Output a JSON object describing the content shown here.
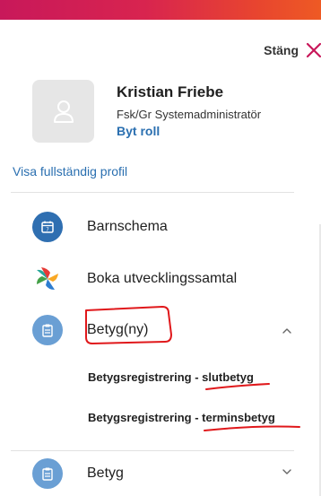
{
  "header": {
    "close_label": "Stäng",
    "close_icon": "close-icon",
    "gradient_colors": [
      "#c8185a",
      "#ee5a24"
    ]
  },
  "profile": {
    "name": "Kristian Friebe",
    "role": "Fsk/Gr Systemadministratör",
    "change_role": "Byt roll",
    "view_profile": "Visa fullständig profil",
    "avatar_icon": "user-icon"
  },
  "menu": {
    "items": [
      {
        "label": "Barnschema",
        "icon": "calendar-icon"
      },
      {
        "label": "Boka utvecklingssamtal",
        "icon": "pinwheel-icon"
      },
      {
        "label": "Betyg(ny)",
        "icon": "clipboard-icon",
        "expanded": true
      },
      {
        "label": "Betyg",
        "icon": "clipboard-icon",
        "expanded": false
      }
    ],
    "subitems": [
      "Betygsregistrering - slutbetyg",
      "Betygsregistrering - terminsbetyg"
    ]
  },
  "colors": {
    "accent": "#2a6fb0",
    "icon_dark": "#2f6fb1",
    "icon_light": "#6a9fd4",
    "annotation": "#e0181b"
  }
}
